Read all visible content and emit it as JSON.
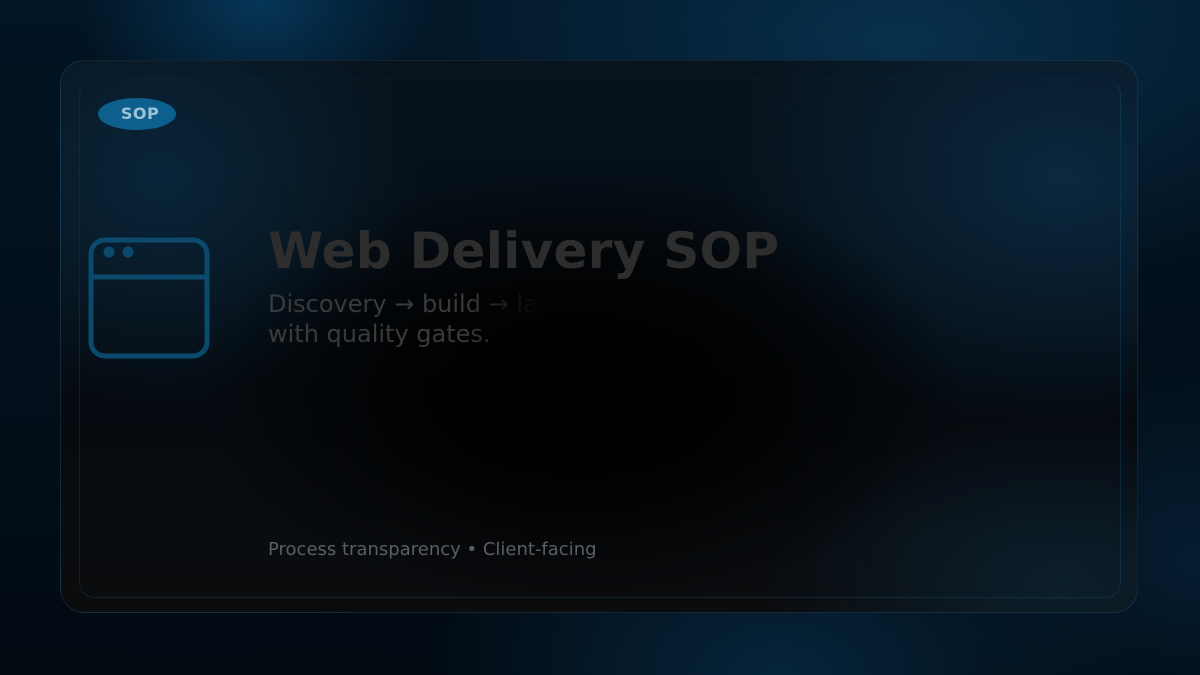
{
  "badge": {
    "label": "SOP"
  },
  "icon": {
    "name": "browser-window-icon",
    "color": "#0b4a6c"
  },
  "title": "Web Delivery SOP",
  "subtitle": "Discovery → build → launch, with quality gates.",
  "footer": "Process transparency • Client-facing",
  "colors": {
    "accent": "#0d5f8d",
    "title": "#2d2d2d",
    "footer": "#5c5f62"
  }
}
